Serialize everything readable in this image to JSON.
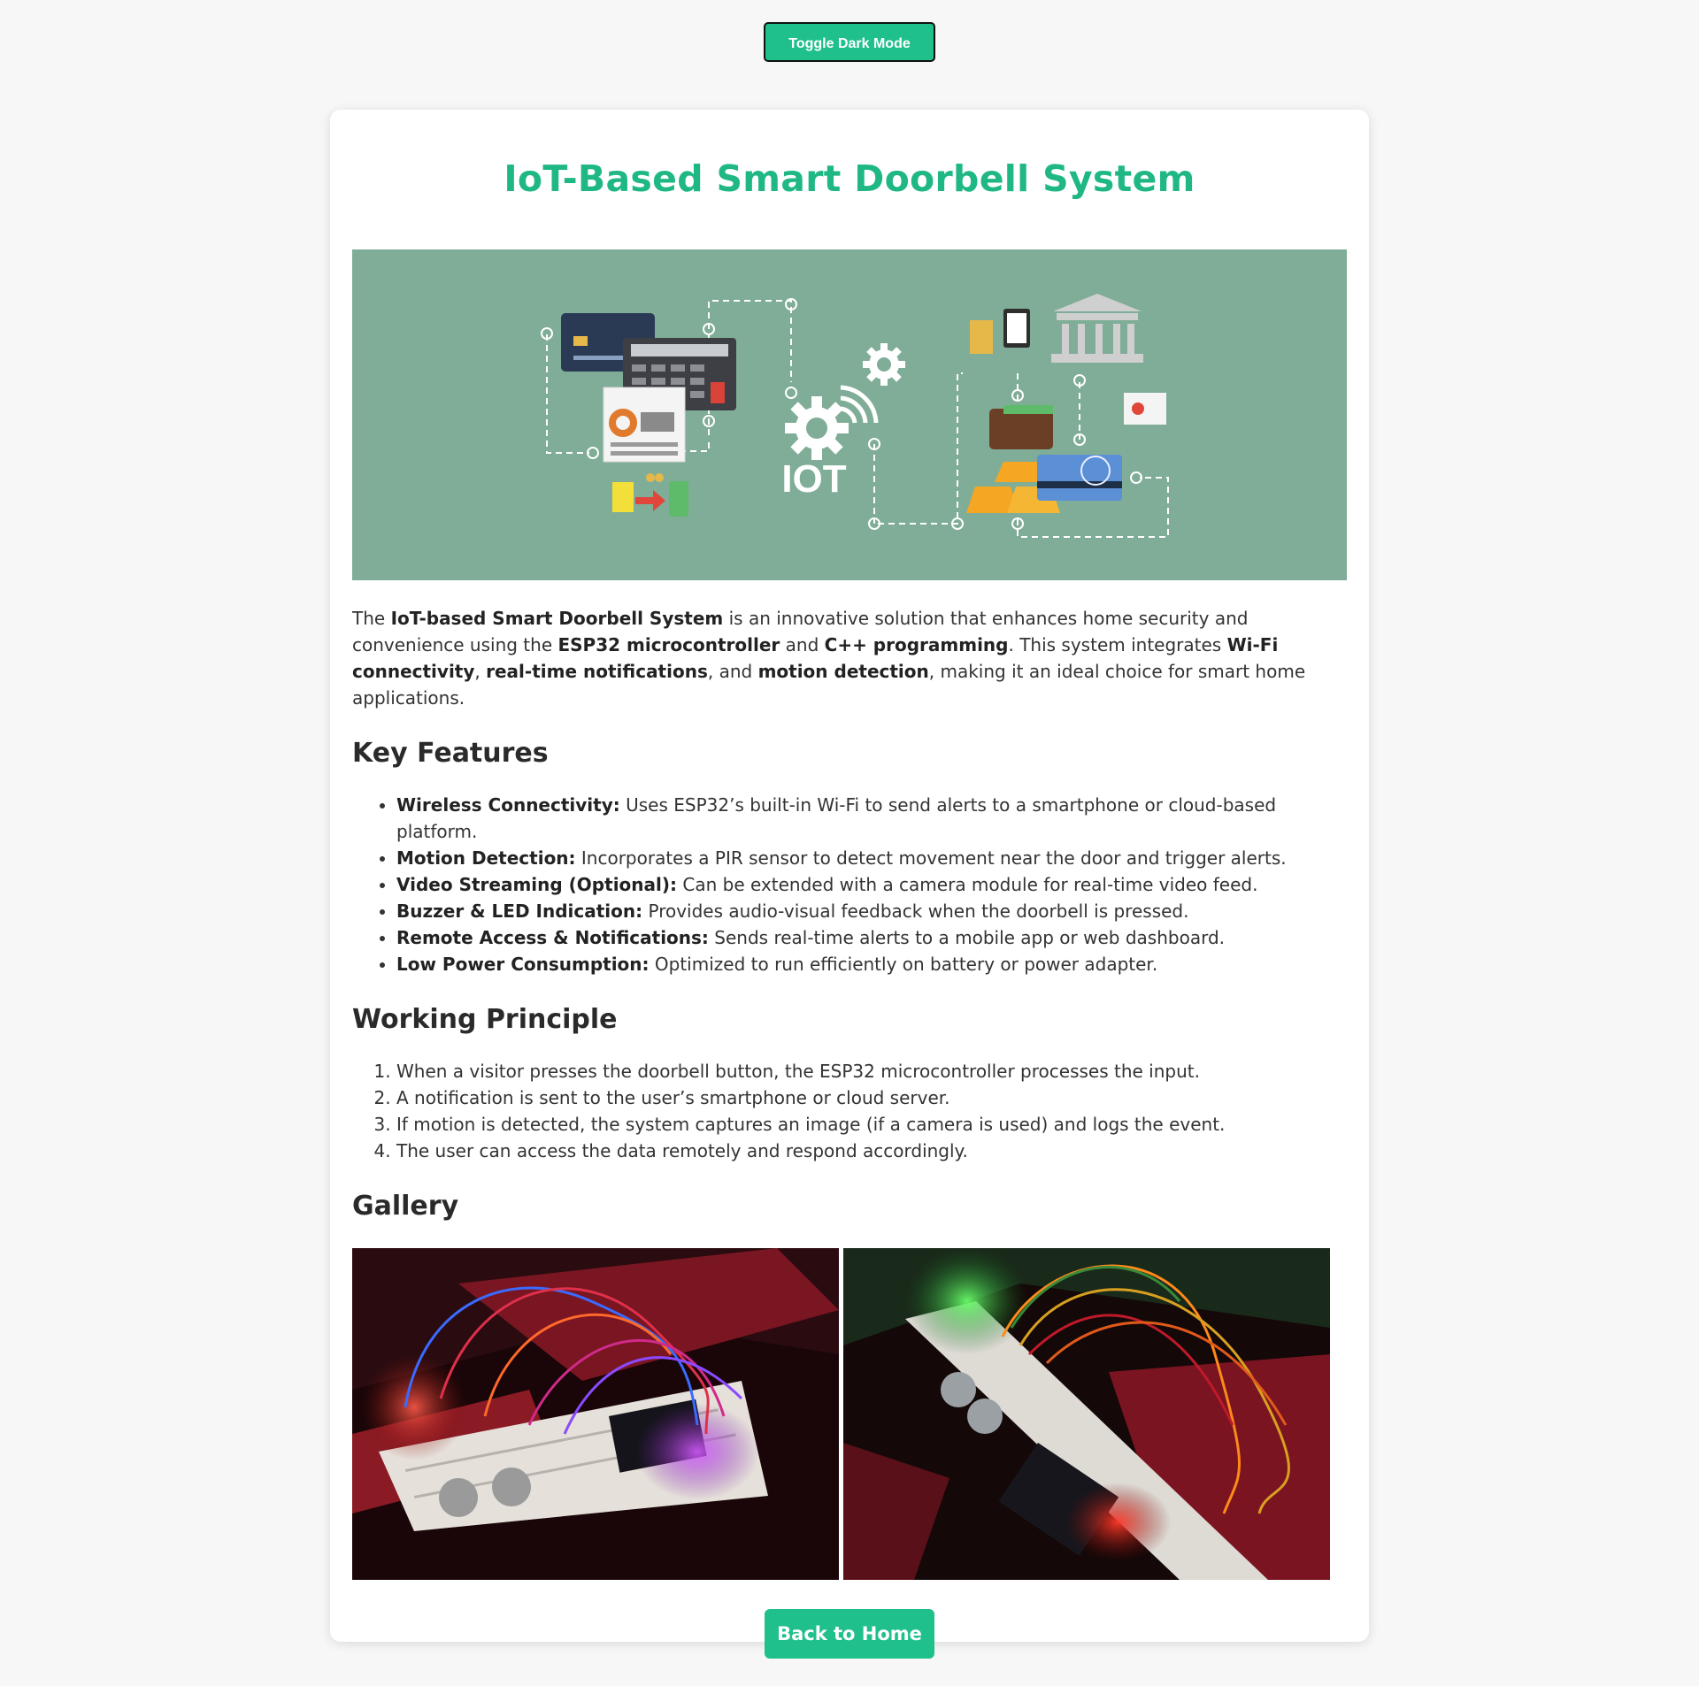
{
  "toggle": {
    "label": "Toggle Dark Mode"
  },
  "title": "IoT-Based Smart Doorbell System",
  "hero": {
    "icon": "iot-illustration",
    "iot_text": "IOT",
    "bg_color": "#7fad97"
  },
  "intro": {
    "t1": "The ",
    "b1": "IoT-based Smart Doorbell System",
    "t2": " is an innovative solution that enhances home security and convenience using the ",
    "b2": "ESP32 microcontroller",
    "t3": " and ",
    "b3": "C++ programming",
    "t4": ". This system integrates ",
    "b4": "Wi-Fi connectivity",
    "t5": ", ",
    "b5": "real-time notifications",
    "t6": ", and ",
    "b6": "motion detection",
    "t7": ", making it an ideal choice for smart home applications."
  },
  "features": {
    "heading": "Key Features",
    "items": [
      {
        "label": "Wireless Connectivity:",
        "text": " Uses ESP32’s built-in Wi-Fi to send alerts to a smartphone or cloud-based platform."
      },
      {
        "label": "Motion Detection:",
        "text": " Incorporates a PIR sensor to detect movement near the door and trigger alerts."
      },
      {
        "label": "Video Streaming (Optional):",
        "text": " Can be extended with a camera module for real-time video feed."
      },
      {
        "label": "Buzzer & LED Indication:",
        "text": " Provides audio-visual feedback when the doorbell is pressed."
      },
      {
        "label": "Remote Access & Notifications:",
        "text": " Sends real-time alerts to a mobile app or web dashboard."
      },
      {
        "label": "Low Power Consumption:",
        "text": " Optimized to run efficiently on battery or power adapter."
      }
    ]
  },
  "working": {
    "heading": "Working Principle",
    "steps": [
      "When a visitor presses the doorbell button, the ESP32 microcontroller processes the input.",
      "A notification is sent to the user’s smartphone or cloud server.",
      "If motion is detected, the system captures an image (if a camera is used) and logs the event.",
      "The user can access the data remotely and respond accordingly."
    ]
  },
  "gallery": {
    "heading": "Gallery",
    "photos": [
      {
        "icon": "breadboard-photo-red-led"
      },
      {
        "icon": "breadboard-photo-green-led"
      }
    ]
  },
  "home_button": {
    "label": "Back to Home"
  },
  "colors": {
    "accent": "#1fc08c",
    "title": "#1fb884",
    "page_bg": "#f7f7f7"
  }
}
